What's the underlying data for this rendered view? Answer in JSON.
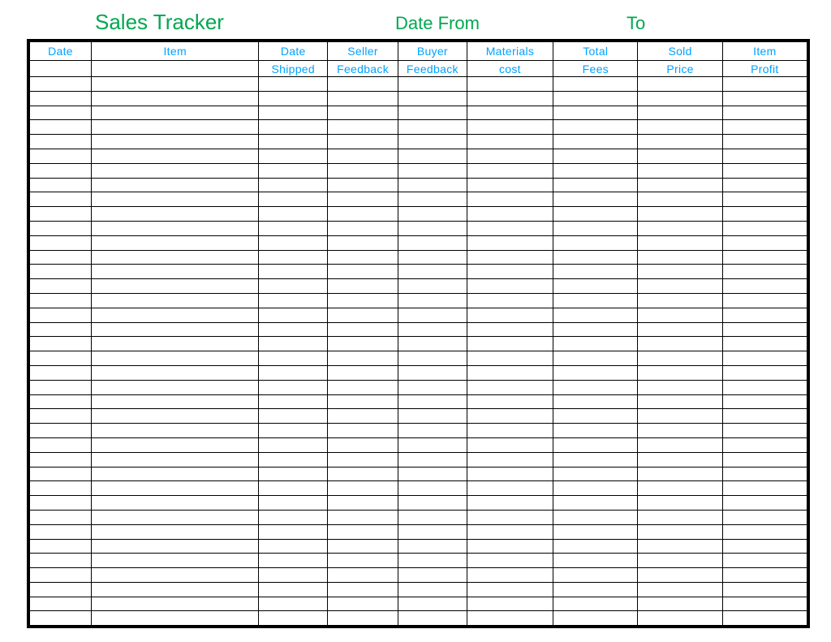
{
  "title": {
    "main": "Sales Tracker",
    "date_from": "Date From",
    "to": "To"
  },
  "columns": [
    {
      "line1": "Date",
      "line2": ""
    },
    {
      "line1": "Item",
      "line2": ""
    },
    {
      "line1": "Date",
      "line2": "Shipped"
    },
    {
      "line1": "Seller",
      "line2": "Feedback"
    },
    {
      "line1": "Buyer",
      "line2": "Feedback"
    },
    {
      "line1": "Materials",
      "line2": "cost"
    },
    {
      "line1": "Total",
      "line2": "Fees"
    },
    {
      "line1": "Sold",
      "line2": "Price"
    },
    {
      "line1": "Item",
      "line2": "Profit"
    }
  ],
  "row_count": 38,
  "colors": {
    "title_green": "#00a84f",
    "header_blue": "#00a1ff",
    "grid_black": "#000000"
  }
}
